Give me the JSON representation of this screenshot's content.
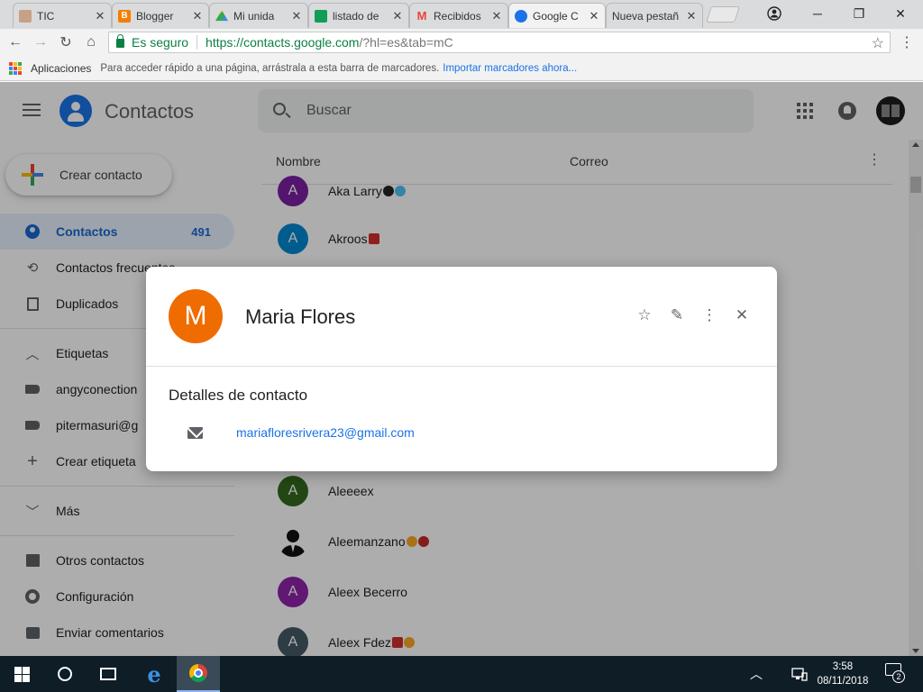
{
  "browser": {
    "tabs": [
      {
        "label": "TIC",
        "favicon": "person-photo-icon",
        "color": "#c7a184"
      },
      {
        "label": "Blogger",
        "favicon": "blogger-icon",
        "color": "#f57d00"
      },
      {
        "label": "Mi unida",
        "favicon": "drive-icon",
        "color": "#34a853"
      },
      {
        "label": "listado de",
        "favicon": "sheets-icon",
        "color": "#0f9d58"
      },
      {
        "label": "Recibidos",
        "favicon": "gmail-icon",
        "color": "#ea4335"
      },
      {
        "label": "Google C",
        "favicon": "contacts-icon",
        "color": "#1a73e8"
      },
      {
        "label": "Nueva pestañ",
        "favicon": "none",
        "color": "#dadbdc"
      }
    ],
    "secure_label": "Es seguro",
    "url_host": "https://contacts.google.com",
    "url_rest": "/?hl=es&tab=mC",
    "bookmarks_apps": "Aplicaciones",
    "bookmarks_hint": "Para acceder rápido a una página, arrástrala a esta barra de marcadores.",
    "bookmarks_import": "Importar marcadores ahora..."
  },
  "app": {
    "title": "Contactos",
    "search_placeholder": "Buscar",
    "create_label": "Crear contacto",
    "accent": "#1a73e8"
  },
  "nav": {
    "contacts": "Contactos",
    "contacts_count": "491",
    "frequent": "Contactos frecuentes",
    "duplicates": "Duplicados",
    "labels_header": "Etiquetas",
    "label1": "angyconection",
    "label2": "pitermasuri@g",
    "create_label": "Crear etiqueta",
    "more": "Más",
    "other_contacts": "Otros contactos",
    "settings": "Configuración",
    "feedback": "Enviar comentarios"
  },
  "list": {
    "col_name": "Nombre",
    "col_email": "Correo",
    "rows": [
      {
        "initial": "A",
        "name": "Aka Larry",
        "color": "#7b1fa2"
      },
      {
        "initial": "A",
        "name": "Akroos",
        "color": "#0288d1"
      },
      {
        "initial": "A",
        "name": "Aleeeex",
        "color": "#33691e"
      },
      {
        "initial": "",
        "name": "Aleemanzano",
        "color": "#ffffff"
      },
      {
        "initial": "A",
        "name": "Aleex Becerro",
        "color": "#8e24aa"
      },
      {
        "initial": "A",
        "name": "Aleex Fdez",
        "color": "#455a64"
      }
    ]
  },
  "dialog": {
    "initial": "M",
    "name": "Maria Flores",
    "section_title": "Detalles de contacto",
    "email": "mariafloresrivera23@gmail.com",
    "avatar_color": "#ef6c00"
  },
  "taskbar": {
    "time": "3:58",
    "date": "08/11/2018",
    "notifications": "2"
  }
}
